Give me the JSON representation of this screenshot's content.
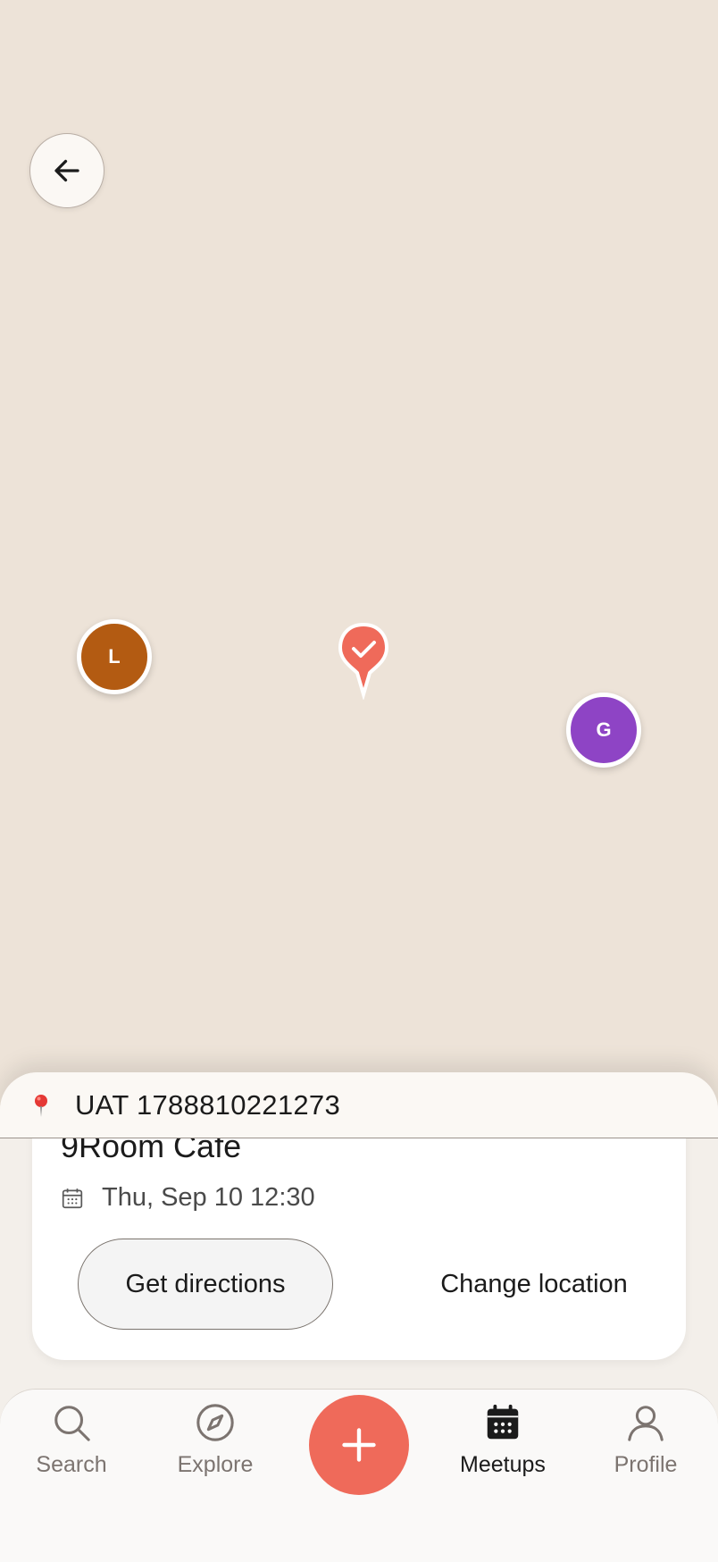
{
  "map": {
    "participants": [
      {
        "initial": "L",
        "color": "#B35B12"
      },
      {
        "initial": "G",
        "color": "#8E44C5"
      }
    ],
    "venue_pin_color": "#EF6A5A"
  },
  "sheet": {
    "title": "UAT 1788810221273",
    "place_name": "9Room Cafe",
    "date": "Thu, Sep 10 12:30",
    "get_directions_label": "Get directions",
    "change_location_label": "Change location"
  },
  "nav": {
    "search": "Search",
    "explore": "Explore",
    "meetups": "Meetups",
    "profile": "Profile",
    "active": "Meetups",
    "accent_color": "#EF6A5A"
  }
}
